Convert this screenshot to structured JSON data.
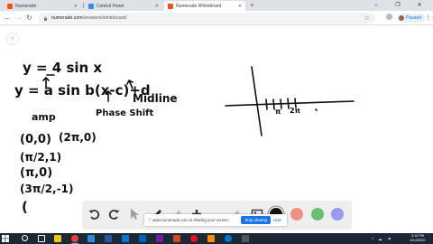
{
  "browser": {
    "tabs": [
      {
        "title": "Numerade",
        "favicon_color": "#f4511e",
        "active": false
      },
      {
        "title": "Control Panel",
        "favicon_color": "#4285f4",
        "active": false
      },
      {
        "title": "Numerade Whiteboard",
        "favicon_color": "#f4511e",
        "active": true
      }
    ],
    "new_tab_glyph": "+",
    "window_controls": {
      "minimize": "–",
      "maximize": "❐",
      "close": "✕"
    },
    "nav": {
      "back": "←",
      "forward": "→",
      "reload": "↻"
    },
    "url_host": "numerade.com",
    "url_path": "/answers/whiteboard/",
    "bookmark_glyph": "☆",
    "profile_status": "Paused",
    "menu_glyph": "⋮"
  },
  "whiteboard": {
    "back_glyph": "‹",
    "handwriting_color": "#111111",
    "handwritten_text": [
      "y = 4 sin x",
      "y = a sin b(x-c)+d",
      "amp",
      "Phase Shift",
      "Midline",
      "(0,0)",
      "(2π,0)",
      "(π/2,1)",
      "(π,0)",
      "(3π/2,-1)",
      "(",
      "π",
      "2π"
    ]
  },
  "draw_toolbar": {
    "tools": [
      "undo-icon",
      "redo-icon",
      "pointer-icon",
      "pen-icon",
      "shape-icon",
      "add-icon",
      "eraser-icon",
      "image-icon"
    ],
    "colors": [
      "#111111",
      "#ef8f86",
      "#6bbf73",
      "#9b9ae8"
    ],
    "selected_color": "#111111"
  },
  "screen_share": {
    "message": "www.numerade.com is sharing your screen.",
    "stop_label": "Stop sharing",
    "hide_label": "Hide"
  },
  "taskbar": {
    "icons": [
      {
        "name": "search-icon",
        "color": "#ffffff"
      },
      {
        "name": "task-view-icon",
        "color": "#ffffff"
      },
      {
        "name": "file-explorer-icon",
        "color": "#f0c419"
      },
      {
        "name": "store-icon",
        "color": "#2d8cd6"
      },
      {
        "name": "chrome-icon",
        "color": "#ea4335"
      },
      {
        "name": "word-icon",
        "color": "#2b579a"
      },
      {
        "name": "mail-icon",
        "color": "#0078d7"
      },
      {
        "name": "photos-icon",
        "color": "#0063b1"
      },
      {
        "name": "music-icon",
        "color": "#e81123"
      },
      {
        "name": "onenote-icon",
        "color": "#7719aa"
      },
      {
        "name": "powerpoint-icon",
        "color": "#d24726"
      },
      {
        "name": "media-icon",
        "color": "#ff8c00"
      },
      {
        "name": "camera-icon",
        "color": "#555555"
      },
      {
        "name": "edge-icon",
        "color": "#0078d7"
      }
    ],
    "time": "3:10 PM",
    "date": "4/14/2020"
  }
}
